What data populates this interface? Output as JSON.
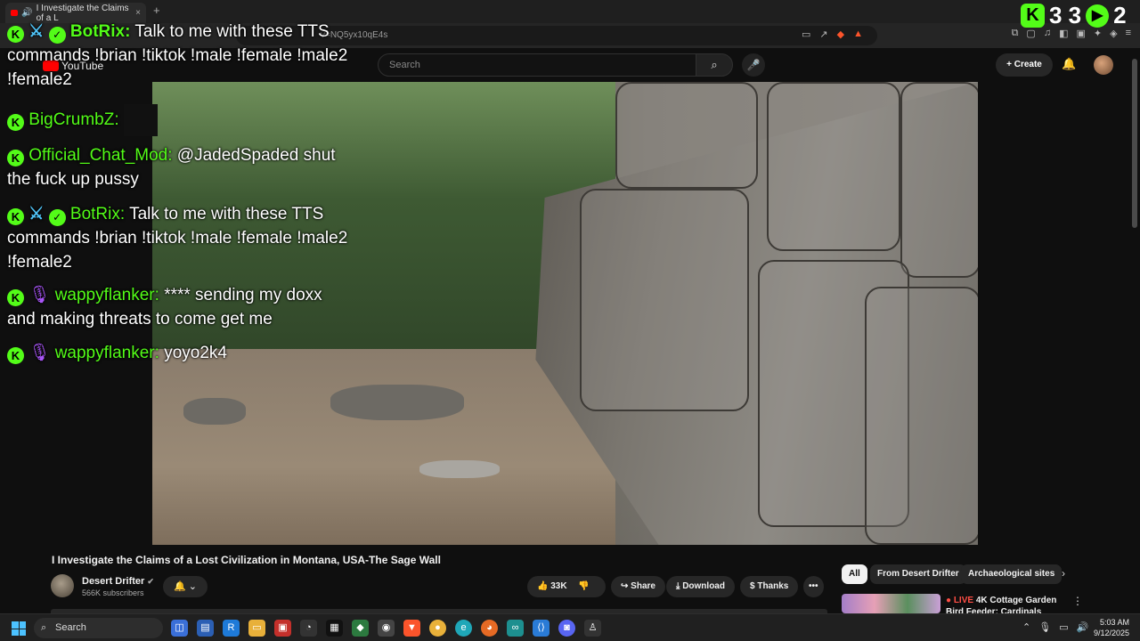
{
  "browser": {
    "tab_title": "I Investigate the Claims of a L",
    "new_tab": "+",
    "tab_close": "×",
    "url": "v=NQ5yx10qE4s"
  },
  "youtube": {
    "logo_text": "YouTube",
    "search_placeholder": "Search",
    "create_label": "Create"
  },
  "kick_counter": {
    "value1": "3 3",
    "value2": "2"
  },
  "chat": [
    {
      "user": "BotRix:",
      "text": "Talk to me with these TTS commands !brian !tiktok !male !female !male2 !female2",
      "badges": [
        "kick",
        "sword",
        "verified"
      ],
      "color": "#53fc18"
    },
    {
      "user": "BigCrumbZ:",
      "text": "",
      "badges": [
        "kick"
      ],
      "color": "#53fc18"
    },
    {
      "user": "Official_Chat_Mod:",
      "text": "@JadedSpaded shut the fuck up pussy",
      "badges": [
        "kick"
      ],
      "color": "#53fc18"
    },
    {
      "user": "BotRix:",
      "text": "Talk to me with these TTS commands !brian !tiktok !male !female !male2 !female2",
      "badges": [
        "kick",
        "sword",
        "verified"
      ],
      "color": "#53fc18"
    },
    {
      "user": "wappyflanker:",
      "text": "**** sending my doxx and making threats to come get me",
      "badges": [
        "kick",
        "mic"
      ],
      "color": "#53fc18"
    },
    {
      "user": "wappyflanker:",
      "text": "yoyo2k4",
      "badges": [
        "kick",
        "mic"
      ],
      "color": "#53fc18"
    }
  ],
  "video": {
    "title": "I Investigate the Claims of a Lost Civilization in Montana, USA-The Sage Wall",
    "channel": "Desert Drifter",
    "subscribers": "566K subscribers",
    "likes": "33K",
    "share": "Share",
    "download": "Download",
    "thanks": "Thanks",
    "more": "•••"
  },
  "chips": [
    "All",
    "From Desert Drifter",
    "Archaeological sites"
  ],
  "recommendation": {
    "live_prefix": "● LIVE",
    "title": "4K Cottage Garden Bird Feeder: Cardinals"
  },
  "taskbar": {
    "search_label": "Search",
    "time": "5:03 AM",
    "date": "9/12/2025"
  },
  "icons": {
    "kick": "K",
    "sword": "⚔",
    "check": "✓",
    "mic": "🎙"
  }
}
